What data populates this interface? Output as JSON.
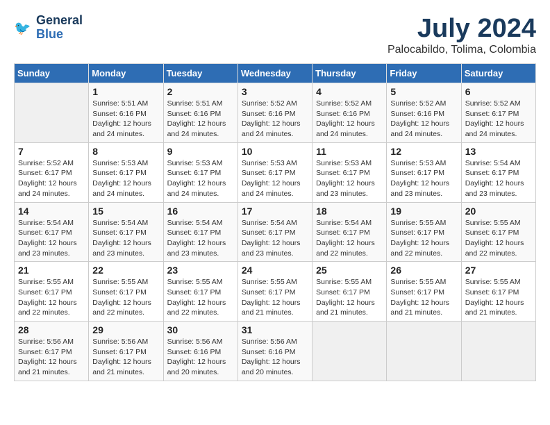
{
  "header": {
    "logo_line1": "General",
    "logo_line2": "Blue",
    "month": "July 2024",
    "location": "Palocabildo, Tolima, Colombia"
  },
  "weekdays": [
    "Sunday",
    "Monday",
    "Tuesday",
    "Wednesday",
    "Thursday",
    "Friday",
    "Saturday"
  ],
  "weeks": [
    [
      {
        "day": "",
        "info": ""
      },
      {
        "day": "1",
        "info": "Sunrise: 5:51 AM\nSunset: 6:16 PM\nDaylight: 12 hours\nand 24 minutes."
      },
      {
        "day": "2",
        "info": "Sunrise: 5:51 AM\nSunset: 6:16 PM\nDaylight: 12 hours\nand 24 minutes."
      },
      {
        "day": "3",
        "info": "Sunrise: 5:52 AM\nSunset: 6:16 PM\nDaylight: 12 hours\nand 24 minutes."
      },
      {
        "day": "4",
        "info": "Sunrise: 5:52 AM\nSunset: 6:16 PM\nDaylight: 12 hours\nand 24 minutes."
      },
      {
        "day": "5",
        "info": "Sunrise: 5:52 AM\nSunset: 6:16 PM\nDaylight: 12 hours\nand 24 minutes."
      },
      {
        "day": "6",
        "info": "Sunrise: 5:52 AM\nSunset: 6:17 PM\nDaylight: 12 hours\nand 24 minutes."
      }
    ],
    [
      {
        "day": "7",
        "info": "Sunrise: 5:52 AM\nSunset: 6:17 PM\nDaylight: 12 hours\nand 24 minutes."
      },
      {
        "day": "8",
        "info": "Sunrise: 5:53 AM\nSunset: 6:17 PM\nDaylight: 12 hours\nand 24 minutes."
      },
      {
        "day": "9",
        "info": "Sunrise: 5:53 AM\nSunset: 6:17 PM\nDaylight: 12 hours\nand 24 minutes."
      },
      {
        "day": "10",
        "info": "Sunrise: 5:53 AM\nSunset: 6:17 PM\nDaylight: 12 hours\nand 24 minutes."
      },
      {
        "day": "11",
        "info": "Sunrise: 5:53 AM\nSunset: 6:17 PM\nDaylight: 12 hours\nand 23 minutes."
      },
      {
        "day": "12",
        "info": "Sunrise: 5:53 AM\nSunset: 6:17 PM\nDaylight: 12 hours\nand 23 minutes."
      },
      {
        "day": "13",
        "info": "Sunrise: 5:54 AM\nSunset: 6:17 PM\nDaylight: 12 hours\nand 23 minutes."
      }
    ],
    [
      {
        "day": "14",
        "info": "Sunrise: 5:54 AM\nSunset: 6:17 PM\nDaylight: 12 hours\nand 23 minutes."
      },
      {
        "day": "15",
        "info": "Sunrise: 5:54 AM\nSunset: 6:17 PM\nDaylight: 12 hours\nand 23 minutes."
      },
      {
        "day": "16",
        "info": "Sunrise: 5:54 AM\nSunset: 6:17 PM\nDaylight: 12 hours\nand 23 minutes."
      },
      {
        "day": "17",
        "info": "Sunrise: 5:54 AM\nSunset: 6:17 PM\nDaylight: 12 hours\nand 23 minutes."
      },
      {
        "day": "18",
        "info": "Sunrise: 5:54 AM\nSunset: 6:17 PM\nDaylight: 12 hours\nand 22 minutes."
      },
      {
        "day": "19",
        "info": "Sunrise: 5:55 AM\nSunset: 6:17 PM\nDaylight: 12 hours\nand 22 minutes."
      },
      {
        "day": "20",
        "info": "Sunrise: 5:55 AM\nSunset: 6:17 PM\nDaylight: 12 hours\nand 22 minutes."
      }
    ],
    [
      {
        "day": "21",
        "info": "Sunrise: 5:55 AM\nSunset: 6:17 PM\nDaylight: 12 hours\nand 22 minutes."
      },
      {
        "day": "22",
        "info": "Sunrise: 5:55 AM\nSunset: 6:17 PM\nDaylight: 12 hours\nand 22 minutes."
      },
      {
        "day": "23",
        "info": "Sunrise: 5:55 AM\nSunset: 6:17 PM\nDaylight: 12 hours\nand 22 minutes."
      },
      {
        "day": "24",
        "info": "Sunrise: 5:55 AM\nSunset: 6:17 PM\nDaylight: 12 hours\nand 21 minutes."
      },
      {
        "day": "25",
        "info": "Sunrise: 5:55 AM\nSunset: 6:17 PM\nDaylight: 12 hours\nand 21 minutes."
      },
      {
        "day": "26",
        "info": "Sunrise: 5:55 AM\nSunset: 6:17 PM\nDaylight: 12 hours\nand 21 minutes."
      },
      {
        "day": "27",
        "info": "Sunrise: 5:55 AM\nSunset: 6:17 PM\nDaylight: 12 hours\nand 21 minutes."
      }
    ],
    [
      {
        "day": "28",
        "info": "Sunrise: 5:56 AM\nSunset: 6:17 PM\nDaylight: 12 hours\nand 21 minutes."
      },
      {
        "day": "29",
        "info": "Sunrise: 5:56 AM\nSunset: 6:17 PM\nDaylight: 12 hours\nand 21 minutes."
      },
      {
        "day": "30",
        "info": "Sunrise: 5:56 AM\nSunset: 6:16 PM\nDaylight: 12 hours\nand 20 minutes."
      },
      {
        "day": "31",
        "info": "Sunrise: 5:56 AM\nSunset: 6:16 PM\nDaylight: 12 hours\nand 20 minutes."
      },
      {
        "day": "",
        "info": ""
      },
      {
        "day": "",
        "info": ""
      },
      {
        "day": "",
        "info": ""
      }
    ]
  ]
}
